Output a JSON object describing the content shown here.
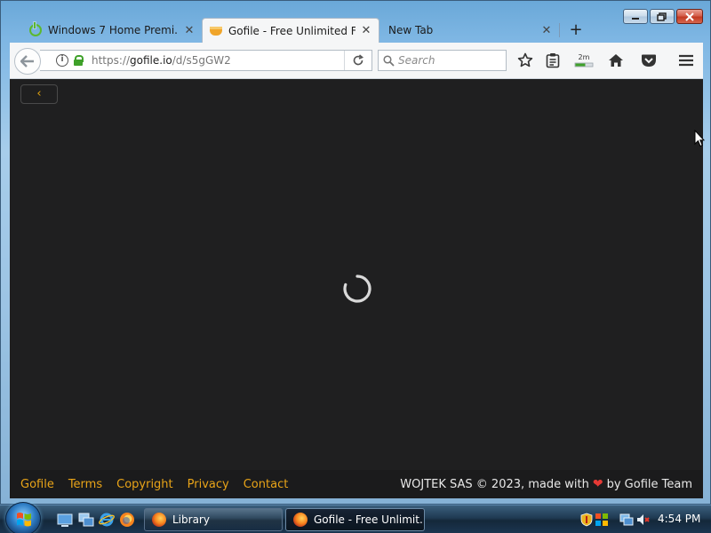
{
  "browser": {
    "tabs": [
      {
        "title": "Windows 7 Home Premi...",
        "favicon": "power-icon",
        "active": false
      },
      {
        "title": "Gofile - Free Unlimited Fil...",
        "favicon": "gofile-icon",
        "active": true
      },
      {
        "title": "New Tab",
        "favicon": "",
        "active": false
      }
    ],
    "tab_close_glyph": "✕",
    "new_tab_glyph": "+",
    "url_scheme": "https://",
    "url_host": "gofile.io",
    "url_path": "/d/s5gGW2",
    "search_placeholder": "Search",
    "downloads_badge": "2m"
  },
  "page": {
    "back_glyph": "‹",
    "footer_links": [
      "Gofile",
      "Terms",
      "Copyright",
      "Privacy",
      "Contact"
    ],
    "credit_prefix": "WOJTEK SAS © 2023, made with",
    "credit_heart": "❤",
    "credit_suffix": "by Gofile Team",
    "accent_color": "#e9a418",
    "background_color": "#1f1f20"
  },
  "taskbar": {
    "tasks": [
      {
        "label": "Library",
        "icon": "firefox-icon",
        "active": false
      },
      {
        "label": "Gofile - Free Unlimit...",
        "icon": "firefox-icon",
        "active": true
      }
    ],
    "clock": "4:54 PM"
  }
}
